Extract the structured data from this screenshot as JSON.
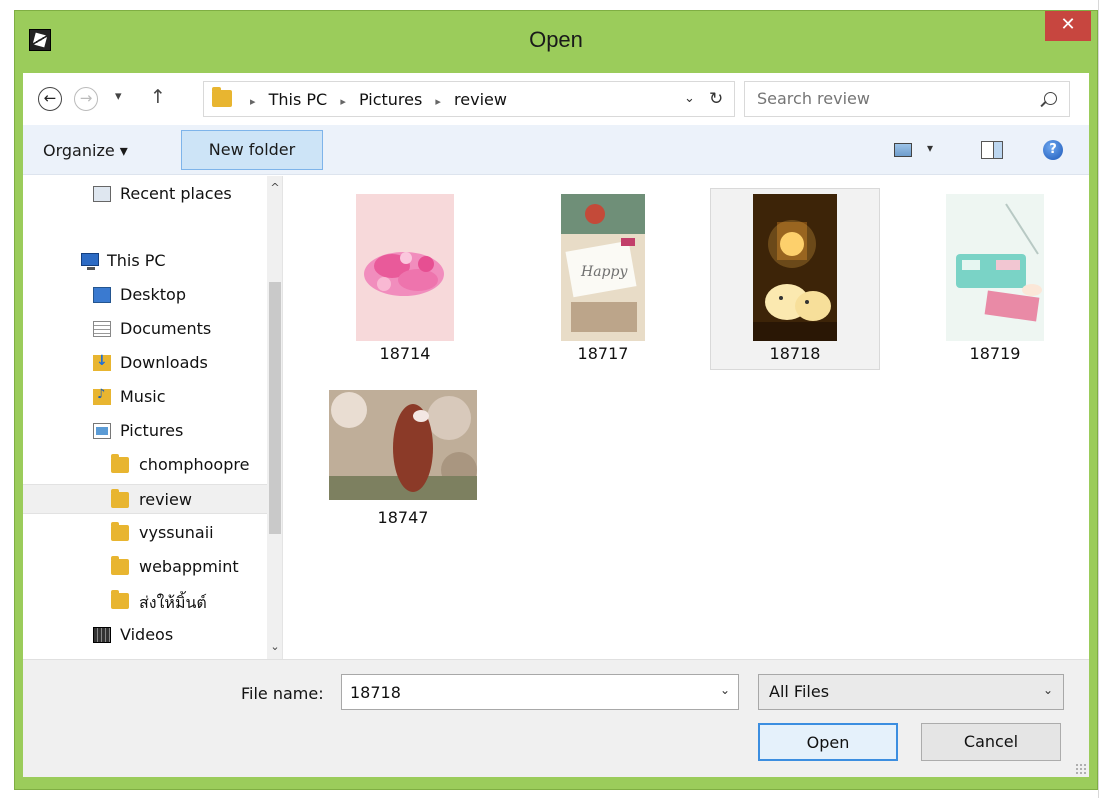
{
  "window": {
    "title": "Open",
    "close_glyph": "✕"
  },
  "address": {
    "crumbs": [
      "This PC",
      "Pictures",
      "review"
    ],
    "separator": "▸",
    "dropdown_glyph": "⌄",
    "refresh_glyph": "↻"
  },
  "nav": {
    "back_glyph": "←",
    "forward_glyph": "→",
    "recent_glyph": "▾",
    "up_glyph": "↑"
  },
  "search": {
    "placeholder": "Search review"
  },
  "toolbar": {
    "organize_label": "Organize ▾",
    "new_folder_label": "New folder",
    "view_dd_glyph": "▾",
    "help_glyph": "?"
  },
  "sidebar": {
    "items": [
      {
        "label": "Recent places",
        "icon": "recent-places-icon"
      },
      {
        "label": "This PC",
        "icon": "computer-icon"
      },
      {
        "label": "Desktop",
        "icon": "desktop-icon"
      },
      {
        "label": "Documents",
        "icon": "documents-icon"
      },
      {
        "label": "Downloads",
        "icon": "downloads-icon"
      },
      {
        "label": "Music",
        "icon": "music-icon"
      },
      {
        "label": "Pictures",
        "icon": "pictures-icon"
      },
      {
        "label": "chomphoopre",
        "icon": "folder-icon"
      },
      {
        "label": "review",
        "icon": "folder-icon",
        "selected": true
      },
      {
        "label": "vyssunaii",
        "icon": "folder-icon"
      },
      {
        "label": "webappmint",
        "icon": "folder-icon"
      },
      {
        "label": "ส่งให้มิ้นต์",
        "icon": "folder-icon"
      },
      {
        "label": "Videos",
        "icon": "videos-icon"
      }
    ],
    "scroll_up_glyph": "^",
    "scroll_down_glyph": "⌄"
  },
  "files": [
    {
      "name": "18714",
      "colors": [
        "#f6d7d8",
        "#ec6fa6"
      ]
    },
    {
      "name": "18717",
      "colors": [
        "#d9c6a8",
        "#c04a5b"
      ]
    },
    {
      "name": "18718",
      "colors": [
        "#5a3510",
        "#f2d47e"
      ],
      "selected": true
    },
    {
      "name": "18719",
      "colors": [
        "#e4f2ec",
        "#7fd3c4"
      ]
    },
    {
      "name": "18747",
      "colors": [
        "#c9b9a8",
        "#8a3f2c"
      ]
    }
  ],
  "bottom": {
    "file_name_label": "File name:",
    "file_name_value": "18718",
    "file_name_dd": "⌄",
    "file_type_value": "All Files",
    "file_type_dd": "⌄",
    "open_label": "Open",
    "cancel_label": "Cancel"
  },
  "colors": {
    "frame": "#9bcc5b",
    "close": "#c7463f",
    "accent": "#3c8ee0",
    "toolbar": "#ecf2fa"
  }
}
